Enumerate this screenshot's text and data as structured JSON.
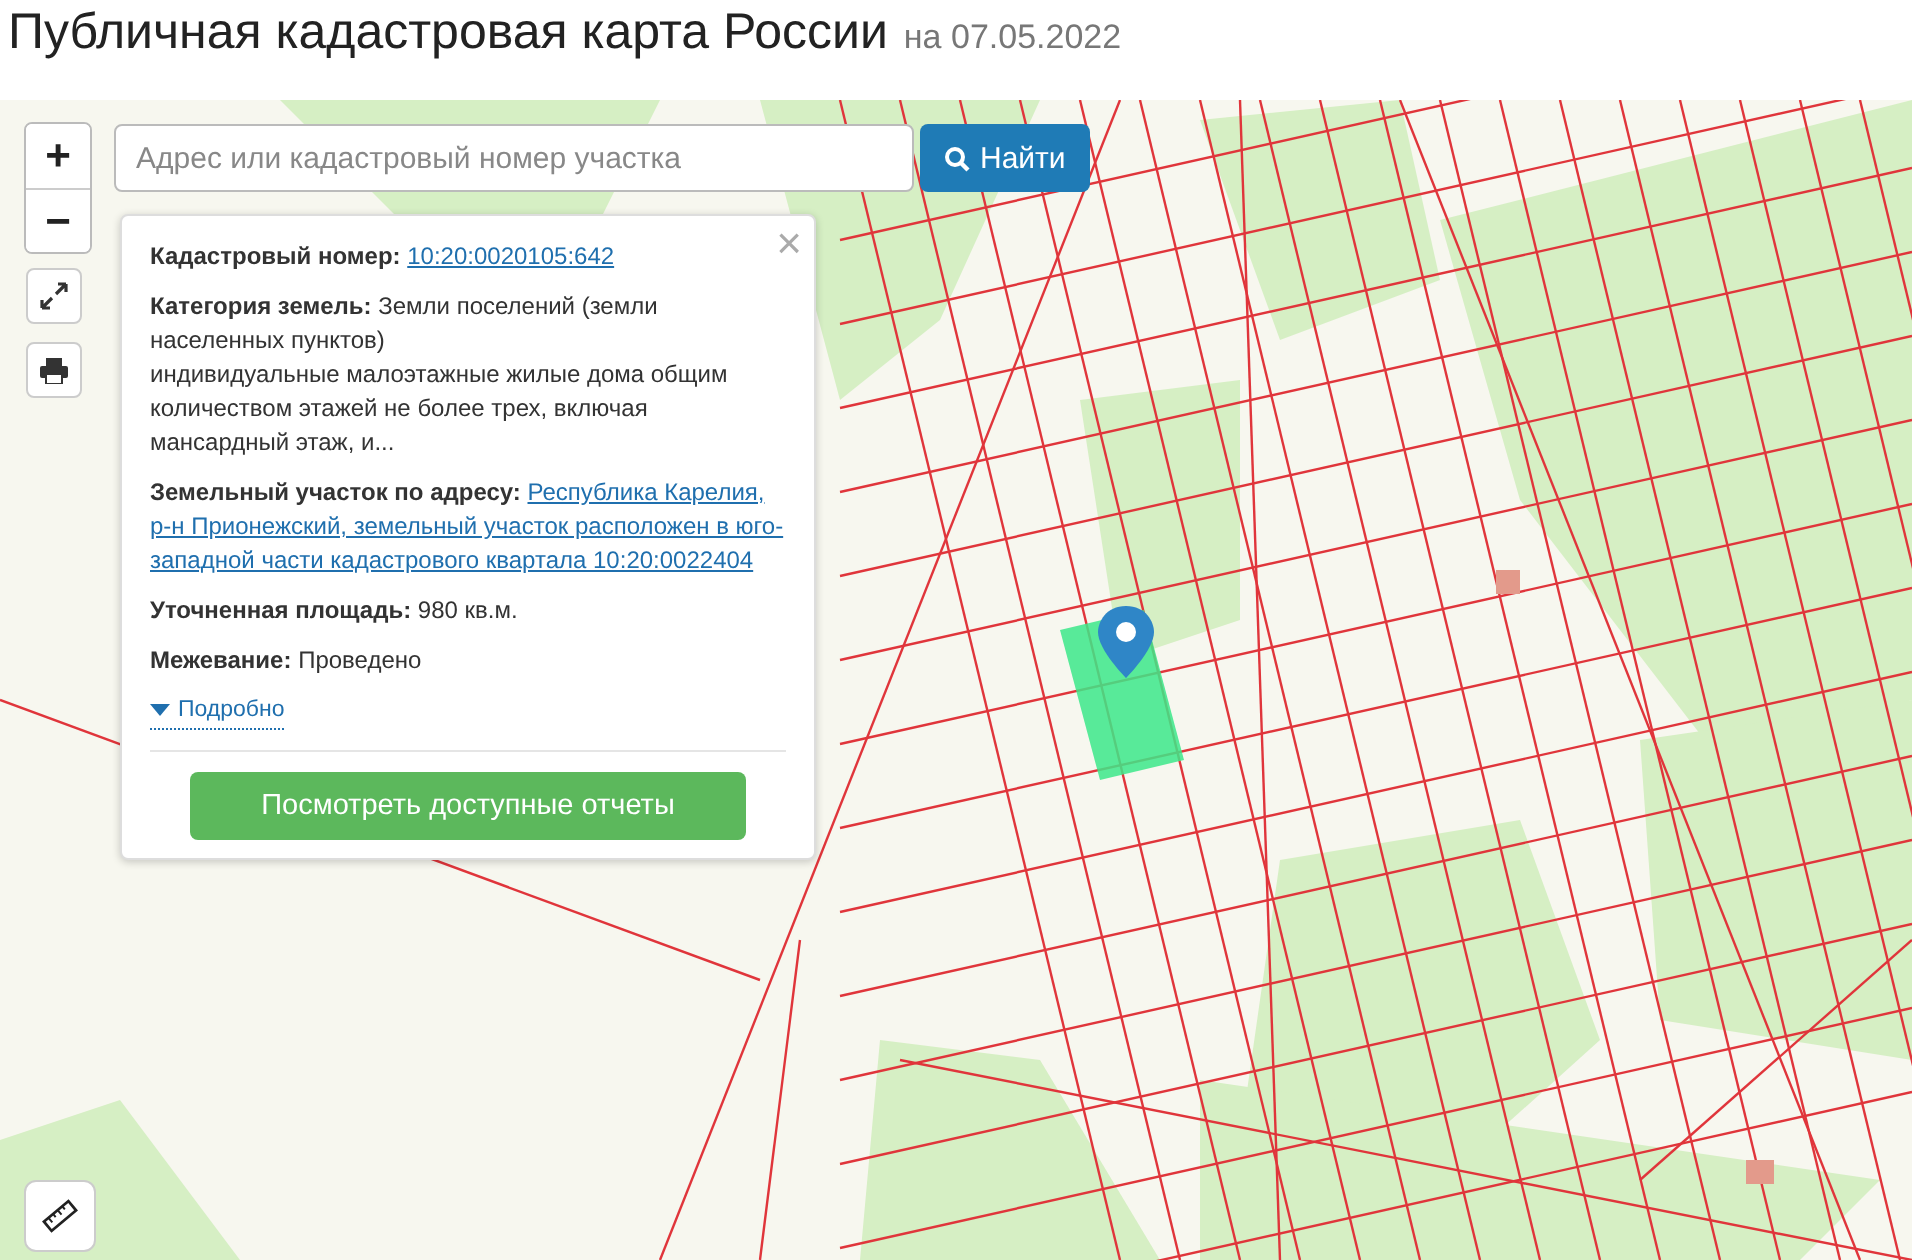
{
  "header": {
    "title": "Публичная кадастровая карта России",
    "date": "на 07.05.2022"
  },
  "map": {
    "zoom_in": "+",
    "zoom_out": "−"
  },
  "search": {
    "placeholder": "Адрес или кадастровый номер участка",
    "button": "Найти"
  },
  "popup": {
    "close": "×",
    "fields": [
      {
        "kind": "link",
        "label": "Кадастровый номер:",
        "value": "10:20:0020105:642"
      },
      {
        "kind": "text",
        "label": "Категория земель:",
        "value": "Земли поселений (земли населенных пунктов)",
        "note": "индивидуальные малоэтажные жилые дома общим количеством этажей не более трех, включая мансардный этаж, и..."
      },
      {
        "kind": "link",
        "label": "Земельный участок по адресу:",
        "value": "Республика Карелия, р-н Прионежский, земельный участок расположен в юго-западной части кадастрового квартала 10:20:0022404"
      },
      {
        "kind": "text",
        "label": "Уточненная площадь:",
        "value": "980 кв.м."
      },
      {
        "kind": "text",
        "label": "Межевание:",
        "value": "Проведено"
      }
    ],
    "details": {
      "label": "Подробно",
      "expanded": false
    },
    "button": "Посмотреть доступные отчеты"
  }
}
